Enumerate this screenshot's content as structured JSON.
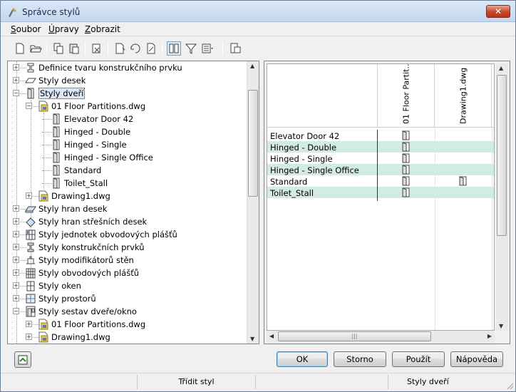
{
  "window": {
    "title": "Správce stylů",
    "close_label": "✕"
  },
  "menu": [
    {
      "label": "Soubor",
      "underline": "S",
      "rest": "oubor"
    },
    {
      "label": "Úpravy",
      "underline": "Ú",
      "rest": "pravy"
    },
    {
      "label": "Zobrazit",
      "underline": "Z",
      "rest": "obrazit"
    }
  ],
  "tree": {
    "items": [
      {
        "label": "Definice tvaru konstrukčního prvku",
        "icon": "member-shape-icon",
        "expander": "+"
      },
      {
        "label": "Styly desek",
        "icon": "slab-style-icon",
        "expander": "+"
      },
      {
        "label": "Styly dveří",
        "icon": "door-style-icon",
        "expander": "−",
        "selected": true
      },
      {
        "label": "01 Floor Partitions.dwg",
        "icon": "drawing-file-icon",
        "expander": "−"
      },
      {
        "label": "Elevator Door 42",
        "icon": "door-icon"
      },
      {
        "label": "Hinged - Double",
        "icon": "door-icon"
      },
      {
        "label": "Hinged - Single",
        "icon": "door-icon"
      },
      {
        "label": "Hinged - Single Office",
        "icon": "door-icon"
      },
      {
        "label": "Standard",
        "icon": "door-icon"
      },
      {
        "label": "Toilet_Stall",
        "icon": "door-icon"
      },
      {
        "label": "Drawing1.dwg",
        "icon": "drawing-file-icon",
        "expander": "+"
      },
      {
        "label": "Styly hran desek",
        "icon": "slab-edge-icon",
        "expander": "+"
      },
      {
        "label": "Styly hran střešních desek",
        "icon": "roof-slab-edge-icon",
        "expander": "+"
      },
      {
        "label": "Styly jednotek obvodových plášťů",
        "icon": "curtain-wall-unit-icon",
        "expander": "+"
      },
      {
        "label": "Styly konstrukčních prvků",
        "icon": "structural-member-icon",
        "expander": "+"
      },
      {
        "label": "Styly modifikátorů stěn",
        "icon": "wall-modifier-icon",
        "expander": "+"
      },
      {
        "label": "Styly obvodových plášťů",
        "icon": "curtain-wall-icon",
        "expander": "+"
      },
      {
        "label": "Styly oken",
        "icon": "window-style-icon",
        "expander": "+"
      },
      {
        "label": "Styly prostorů",
        "icon": "space-style-icon",
        "expander": "+"
      },
      {
        "label": "Styly sestav dveře/okno",
        "icon": "door-window-assembly-icon",
        "expander": "−"
      },
      {
        "label": "01 Floor Partitions.dwg",
        "icon": "drawing-file-icon",
        "expander": "+"
      },
      {
        "label": "Drawing1.dwg",
        "icon": "drawing-file-icon",
        "expander": "+"
      }
    ]
  },
  "grid": {
    "columns": [
      "01 Floor Partit...",
      "Drawing1.dwg"
    ],
    "rows": [
      {
        "name": "Elevator Door 42",
        "col1": true,
        "col2": false
      },
      {
        "name": "Hinged - Double",
        "col1": true,
        "col2": false
      },
      {
        "name": "Hinged - Single",
        "col1": true,
        "col2": false
      },
      {
        "name": "Hinged - Single Office",
        "col1": true,
        "col2": false
      },
      {
        "name": "Standard",
        "col1": true,
        "col2": true
      },
      {
        "name": "Toilet_Stall",
        "col1": true,
        "col2": false
      }
    ],
    "row_alt_color": "#d2ecdf"
  },
  "buttons": {
    "ok": "OK",
    "cancel": "Storno",
    "apply": "Použít",
    "help": "Nápověda"
  },
  "status": {
    "left": "",
    "middle": "Třídit styl",
    "right": "Styly dveří"
  }
}
